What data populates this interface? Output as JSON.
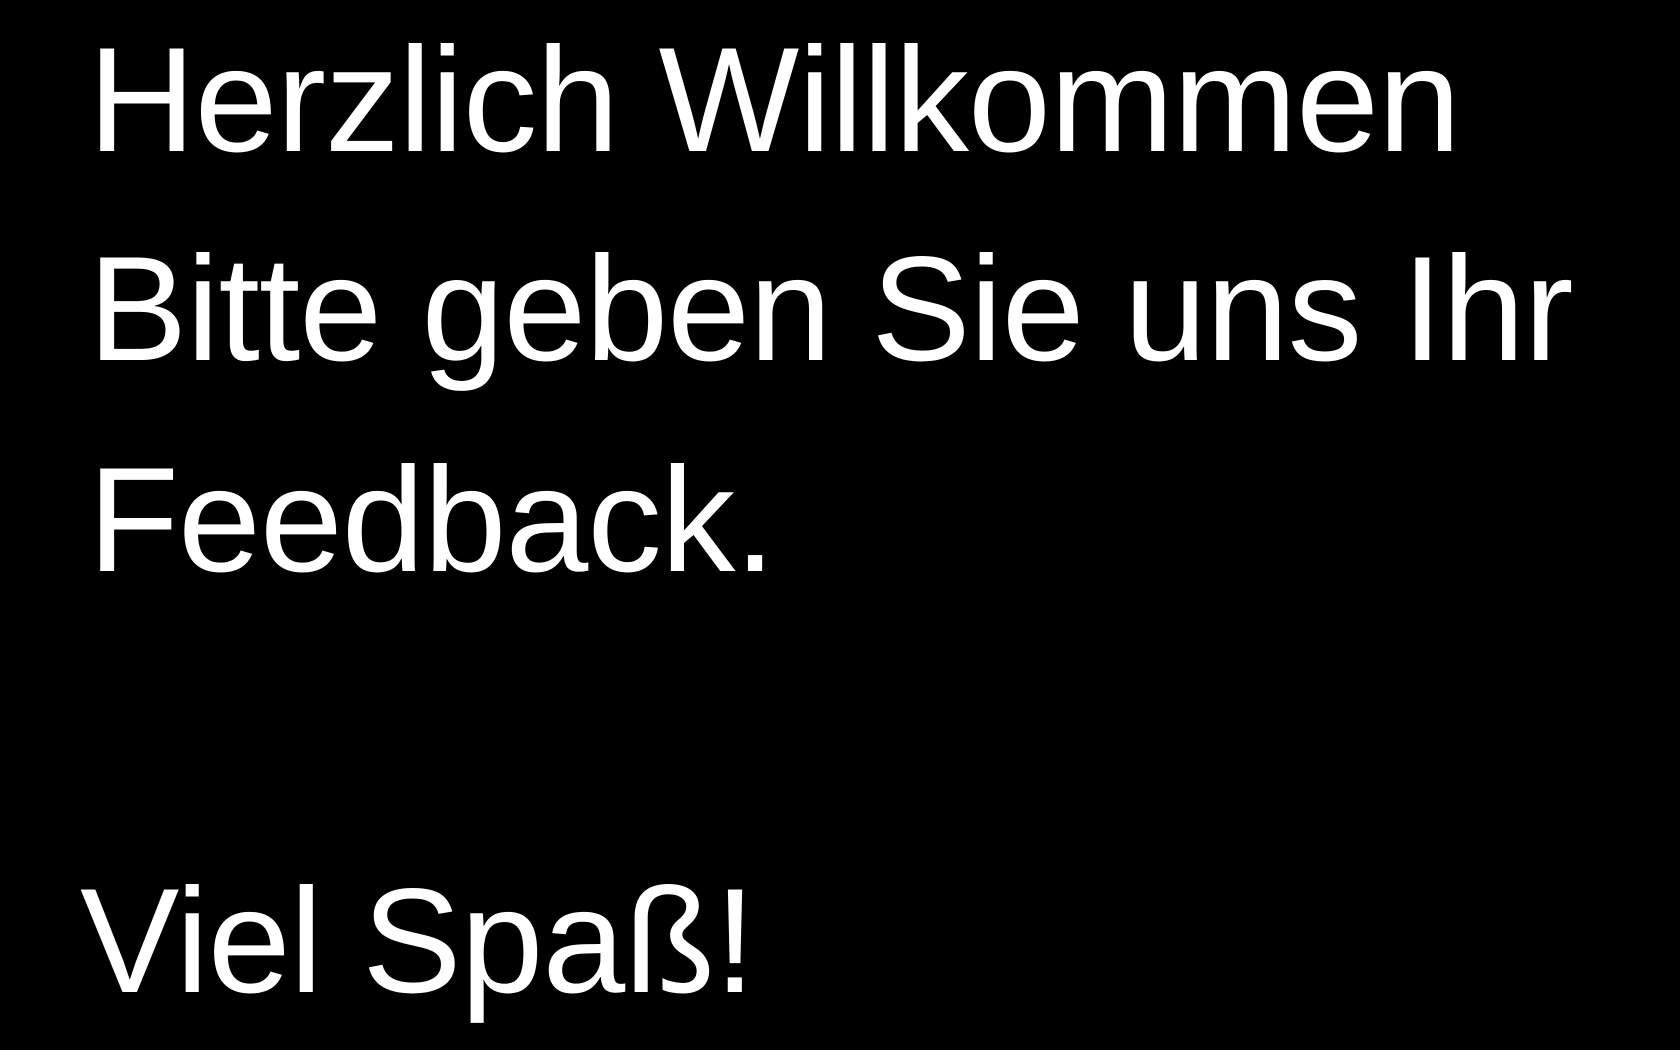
{
  "screen": {
    "background_color": "#000000",
    "text_color": "#ffffff"
  },
  "welcome": {
    "heading": "Herzlich Willkommen",
    "request_line_1": "Bitte geben Sie uns Ihr",
    "request_line_2": "Feedback.",
    "closing": "Viel Spaß!"
  }
}
